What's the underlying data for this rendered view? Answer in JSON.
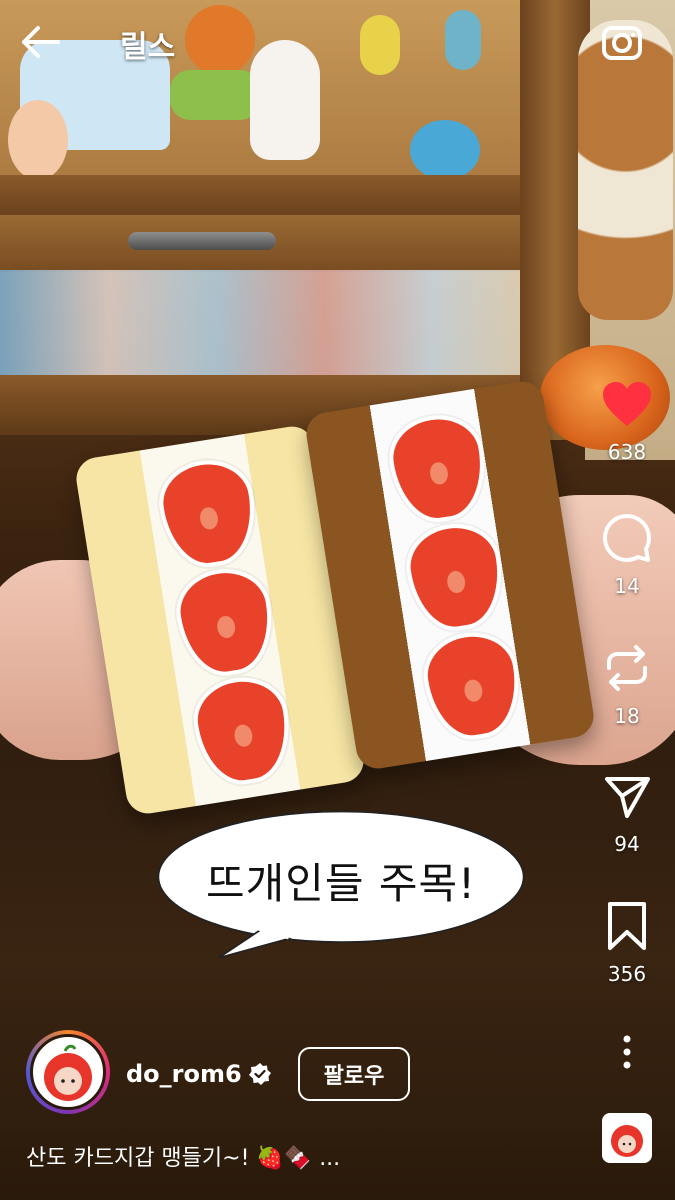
{
  "header": {
    "title": "릴스",
    "back_icon": "arrow-left-icon",
    "camera_icon": "camera-icon"
  },
  "overlay": {
    "speech_bubble": "뜨개인들 주목!"
  },
  "actions": {
    "like": {
      "icon": "heart-icon",
      "count": "638",
      "color": "#ff3040",
      "liked": true
    },
    "comment": {
      "icon": "comment-icon",
      "count": "14"
    },
    "repost": {
      "icon": "repost-icon",
      "count": "18"
    },
    "share": {
      "icon": "send-icon",
      "count": "94"
    },
    "save": {
      "icon": "bookmark-icon",
      "count": "356"
    },
    "more": {
      "icon": "more-vertical-icon"
    }
  },
  "author": {
    "username": "do_rom6",
    "verified": true,
    "follow_label": "팔로우"
  },
  "caption": {
    "text": "산도 카드지갑 맹들기~! 🍓🍫",
    "more": "..."
  },
  "colors": {
    "like": "#ff3040",
    "story_ring": [
      "#f58529",
      "#dd2a7b",
      "#8134af"
    ]
  }
}
